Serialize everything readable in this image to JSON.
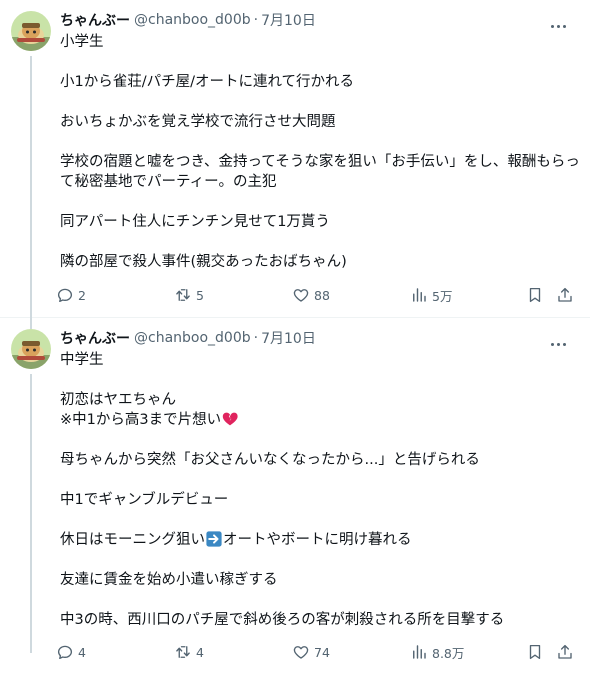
{
  "tweets": [
    {
      "author_name": "ちゃんぶー",
      "handle": "@chanboo_d00b",
      "separator": "·",
      "date": "7月10日",
      "paragraphs": [
        "小学生",
        "小1から雀荘/パチ屋/オートに連れて行かれる",
        "おいちょかぶを覚え学校で流行させ大問題",
        "学校の宿題と嘘をつき、金持ってそうな家を狙い「お手伝い」をし、報酬もらって秘密基地でパーティー。の主犯",
        "同アパート住人にチンチン見せて1万貰う",
        "隣の部屋で殺人事件(親交あったおばちゃん)"
      ],
      "replies": "2",
      "retweets": "5",
      "likes": "88",
      "views": "5万"
    },
    {
      "author_name": "ちゃんぶー",
      "handle": "@chanboo_d00b",
      "separator": "·",
      "date": "7月10日",
      "p1": "中学生",
      "p2_line1": "初恋はヤエちゃん",
      "p2_line2": "※中1から高3まで片想い",
      "p3": "母ちゃんから突然「お父さんいなくなったから...」と告げられる",
      "p4": "中1でギャンブルデビュー",
      "p5_before": "休日はモーニング狙い",
      "p5_after": "オートやボートに明け暮れる",
      "p6": "友達に賃金を始め小遣い稼ぎする",
      "p7": "中3の時、西川口のパチ屋で斜め後ろの客が刺殺される所を目撃する",
      "replies": "4",
      "retweets": "4",
      "likes": "74",
      "views": "8.8万"
    }
  ],
  "icons": {
    "more": "more-dots-icon",
    "reply": "reply-bubble-icon",
    "retweet": "retweet-arrows-icon",
    "like": "heart-icon",
    "views": "views-bar-chart-icon",
    "bookmark": "bookmark-icon",
    "share": "share-upload-icon",
    "broken_heart": "broken-heart-emoji",
    "right_arrow": "right-arrow-emoji"
  },
  "colors": {
    "text_primary": "#0f1419",
    "text_secondary": "#536471",
    "divider": "#eff3f4",
    "thread_line": "#cfd9de",
    "emoji_heart": "#e0245e",
    "emoji_arrow_bg": "#3b88c3"
  }
}
